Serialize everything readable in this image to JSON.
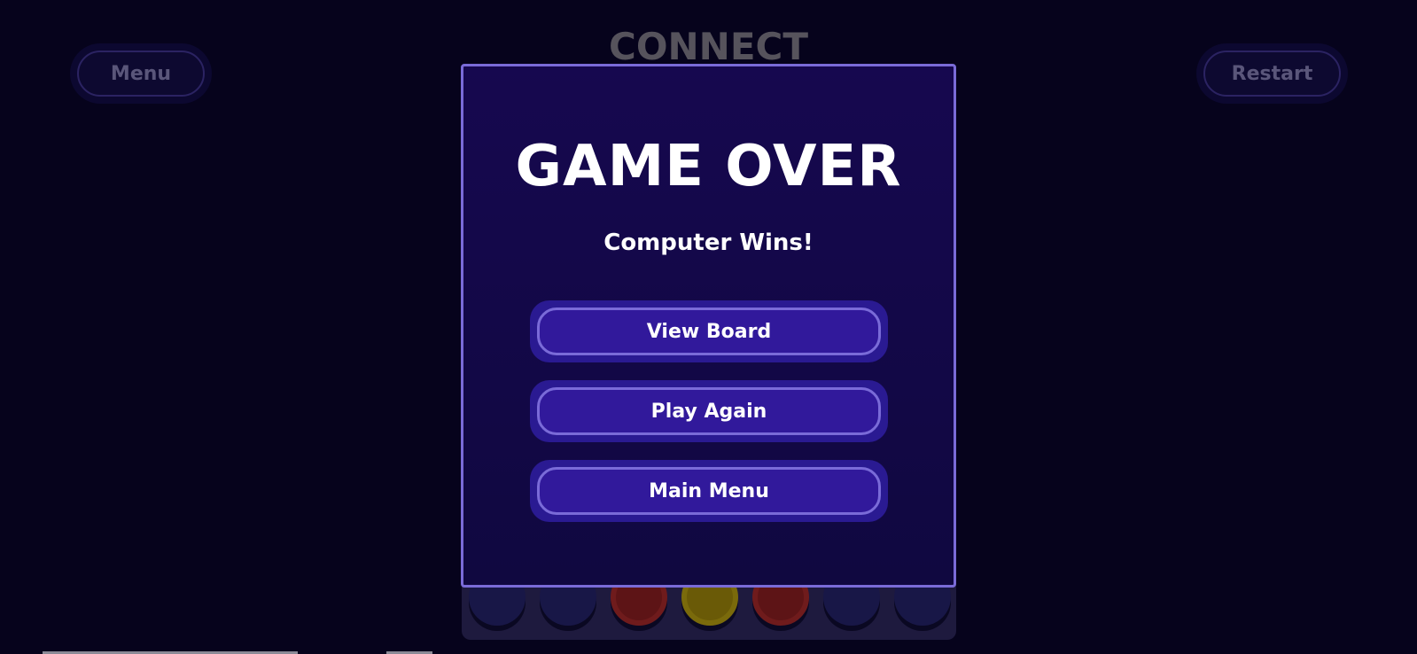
{
  "background": {
    "title": "CONNECT",
    "menu_label": "Menu",
    "restart_label": "Restart",
    "board_row": [
      "empty",
      "empty",
      "red",
      "yellow",
      "red",
      "empty",
      "empty"
    ]
  },
  "modal": {
    "title": "GAME OVER",
    "result": "Computer Wins!",
    "buttons": {
      "view_board": "View Board",
      "play_again": "Play Again",
      "main_menu": "Main Menu"
    }
  },
  "colors": {
    "accent": "#7a6bd8",
    "modal_bg": "#16084f",
    "button_bg": "#31199b",
    "red_disc": "#c8282a",
    "yellow_disc": "#e8c80e"
  }
}
